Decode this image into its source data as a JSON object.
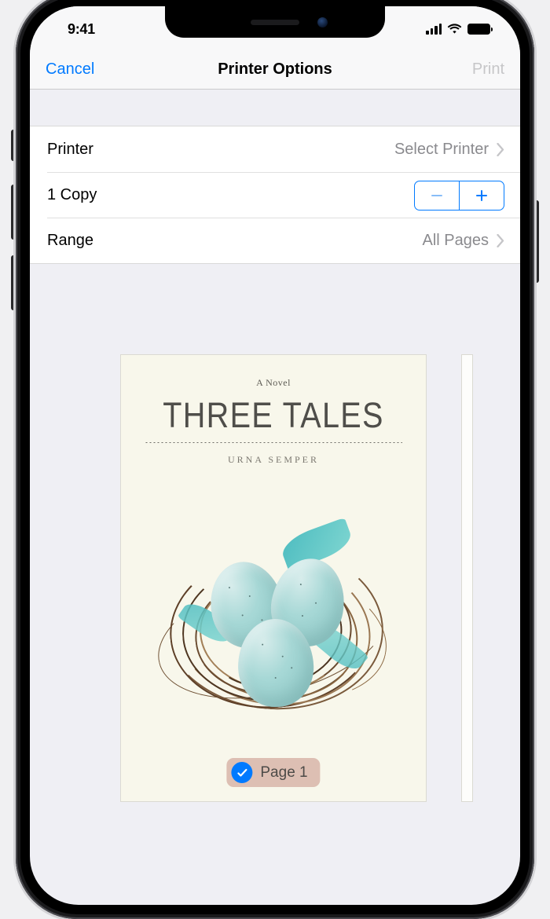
{
  "status": {
    "time": "9:41"
  },
  "nav": {
    "cancel": "Cancel",
    "title": "Printer Options",
    "print": "Print"
  },
  "rows": {
    "printer": {
      "label": "Printer",
      "value": "Select Printer"
    },
    "copies": {
      "label": "1 Copy"
    },
    "range": {
      "label": "Range",
      "value": "All Pages"
    }
  },
  "preview": {
    "subtitle": "A Novel",
    "title": "THREE TALES",
    "author": "URNA SEMPER",
    "page_label": "Page 1"
  },
  "colors": {
    "accent": "#007aff"
  }
}
